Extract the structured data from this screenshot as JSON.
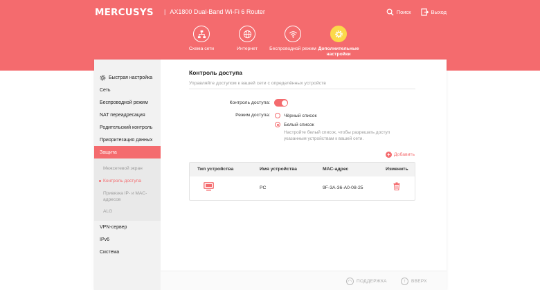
{
  "header": {
    "logo": "MERCUSYS",
    "separator": "|",
    "model": "AX1800 Dual-Band Wi-Fi 6 Router",
    "search_label": "Поиск",
    "logout_label": "Выход",
    "brand_color": "#f46b6e",
    "active_color": "#fbd94a"
  },
  "tabs": [
    {
      "label": "Схема сети",
      "icon": "network-map-icon"
    },
    {
      "label": "Интернет",
      "icon": "globe-icon"
    },
    {
      "label": "Беспроводной режим",
      "icon": "wifi-icon"
    },
    {
      "label": "Дополнительные настройки",
      "icon": "gear-icon",
      "active": true
    }
  ],
  "sidebar": {
    "quick_setup": "Быстрая настройка",
    "items": [
      "Сеть",
      "Беспроводной режим",
      "NAT переадресация",
      "Родительский контроль",
      "Приоритезация данных",
      "Защита"
    ],
    "subitems": [
      "Межсетевой экран",
      "Контроль доступа",
      "Привязка IP- и MAC-адресов",
      "ALG"
    ],
    "items_after": [
      "VPN-сервер",
      "IPv6",
      "Система"
    ],
    "active_item": "Защита",
    "active_subitem": "Контроль доступа"
  },
  "content": {
    "title": "Контроль доступа",
    "description": "Управляйте доступом к вашей сети с определённых устройств",
    "access_control_label": "Контроль доступа:",
    "access_control_enabled": true,
    "mode_label": "Режим доступа:",
    "blacklist_label": "Чёрный список",
    "whitelist_label": "Белый список",
    "selected_mode": "Белый список",
    "whitelist_hint": "Настройте белый список, чтобы разрешать доступ указанным устройствам к вашей сети.",
    "add_label": "Добавить"
  },
  "table": {
    "columns": [
      "Тип устройства",
      "Имя устройства",
      "МАС-адрес",
      "Изменить"
    ],
    "rows": [
      {
        "type_icon": "computer-icon",
        "name": "PC",
        "mac": "9F-3A-36-A0-08-25",
        "action_icon": "trash-icon"
      }
    ]
  },
  "footer": {
    "support_label": "ПОДДЕРЖКА",
    "up_label": "ВВЕРХ"
  }
}
